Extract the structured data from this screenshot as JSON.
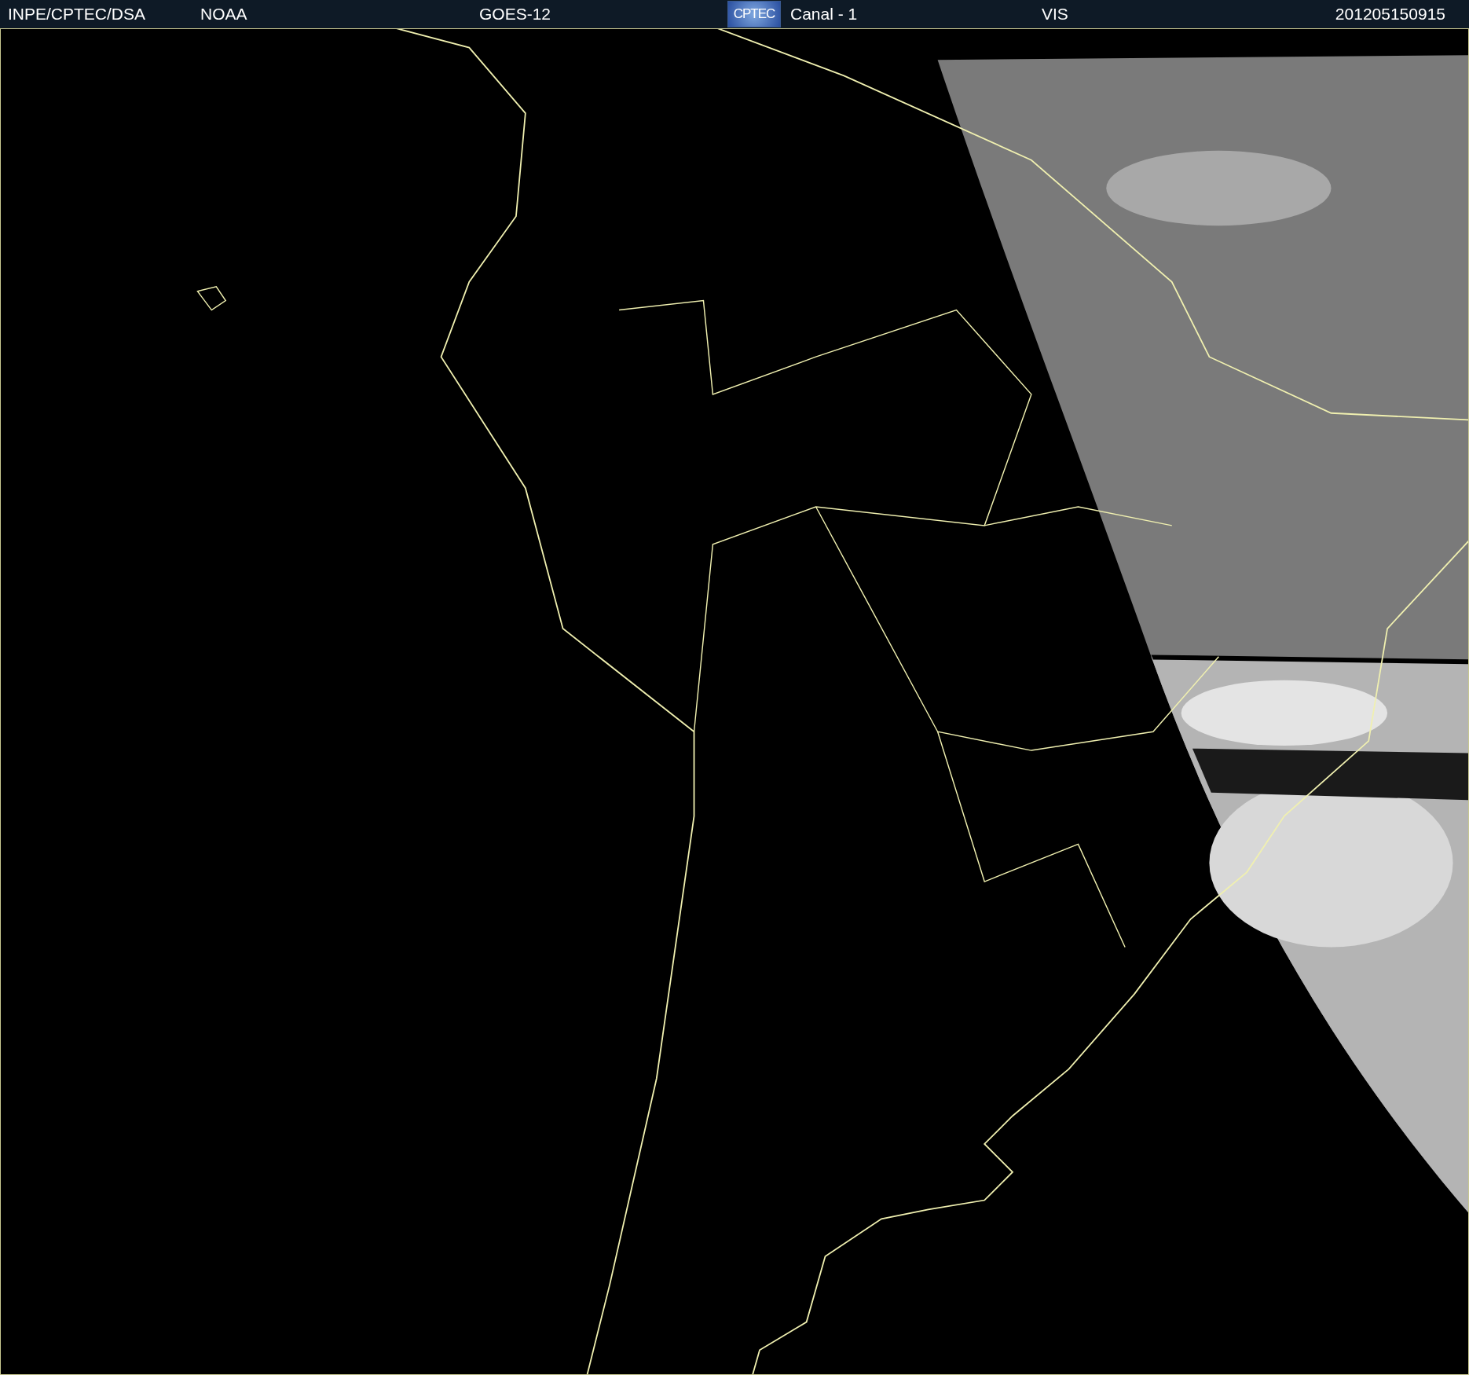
{
  "header": {
    "source": "INPE/CPTEC/DSA",
    "agency": "NOAA",
    "satellite": "GOES-12",
    "logo": "CPTEC",
    "channel": "Canal - 1",
    "band": "VIS",
    "timestamp": "201205150915"
  }
}
